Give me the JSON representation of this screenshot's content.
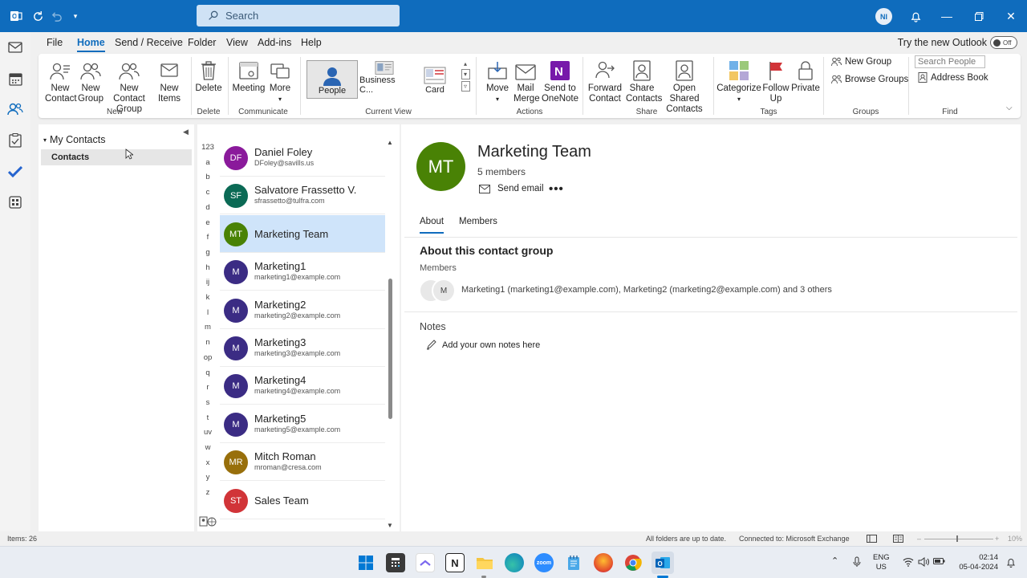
{
  "titlebar": {
    "search_placeholder": "Search",
    "avatar_initials": "NI"
  },
  "menu": {
    "tabs": [
      "File",
      "Home",
      "Send / Receive",
      "Folder",
      "View",
      "Add-ins",
      "Help"
    ],
    "active_tab": "Home",
    "try_new_label": "Try the new Outlook",
    "toggle_label": "Off"
  },
  "ribbon": {
    "new_contact": "New Contact",
    "new_group": "New Group",
    "new_contact_group": "New Contact Group",
    "new_items": "New Items",
    "group_new": "New",
    "delete": "Delete",
    "group_delete": "Delete",
    "meeting": "Meeting",
    "more": "More",
    "group_communicate": "Communicate",
    "view_people": "People",
    "view_business": "Business C...",
    "view_card": "Card",
    "group_current_view": "Current View",
    "move": "Move",
    "mail_merge": "Mail Merge",
    "send_onenote": "Send to OneNote",
    "group_actions": "Actions",
    "forward_contact": "Forward Contact",
    "share_contacts": "Share Contacts",
    "open_shared": "Open Shared Contacts",
    "group_share": "Share",
    "categorize": "Categorize",
    "follow_up": "Follow Up",
    "private": "Private",
    "group_tags": "Tags",
    "new_group_small": "New Group",
    "browse_groups": "Browse Groups",
    "group_groups": "Groups",
    "search_people_placeholder": "Search People",
    "address_book": "Address Book",
    "group_find": "Find"
  },
  "folder_pane": {
    "header": "My Contacts",
    "selected": "Contacts"
  },
  "alphabet": [
    "123",
    "a",
    "b",
    "c",
    "d",
    "e",
    "f",
    "g",
    "h",
    "ij",
    "k",
    "l",
    "m",
    "n",
    "op",
    "q",
    "r",
    "s",
    "t",
    "uv",
    "w",
    "x",
    "y",
    "z"
  ],
  "contacts": [
    {
      "initials": "DF",
      "name": "Daniel Foley",
      "email": "DFoley@savills.us",
      "color": "#8a1a9b"
    },
    {
      "initials": "SF",
      "name": "Salvatore Frassetto V.",
      "email": "sfrassetto@tulfra.com",
      "color": "#0b6a55"
    },
    {
      "initials": "MT",
      "name": "Marketing Team",
      "email": "",
      "color": "#498205"
    },
    {
      "initials": "M",
      "name": "Marketing1",
      "email": "marketing1@example.com",
      "color": "#3b2c84"
    },
    {
      "initials": "M",
      "name": "Marketing2",
      "email": "marketing2@example.com",
      "color": "#3b2c84"
    },
    {
      "initials": "M",
      "name": "Marketing3",
      "email": "marketing3@example.com",
      "color": "#3b2c84"
    },
    {
      "initials": "M",
      "name": "Marketing4",
      "email": "marketing4@example.com",
      "color": "#3b2c84"
    },
    {
      "initials": "M",
      "name": "Marketing5",
      "email": "marketing5@example.com",
      "color": "#3b2c84"
    },
    {
      "initials": "MR",
      "name": "Mitch Roman",
      "email": "mroman@cresa.com",
      "color": "#986f0b"
    },
    {
      "initials": "ST",
      "name": "Sales Team",
      "email": "",
      "color": "#d13438"
    }
  ],
  "reading_pane": {
    "initials": "MT",
    "name": "Marketing Team",
    "member_count": "5 members",
    "send_email": "Send email",
    "tabs": [
      "About",
      "Members"
    ],
    "about_title": "About this contact group",
    "members_label": "Members",
    "members_text": "Marketing1 (marketing1@example.com), Marketing2 (marketing2@example.com) and 3 others",
    "notes_label": "Notes",
    "add_notes": "Add your own notes here",
    "member_avatar": "M"
  },
  "statusbar": {
    "items": "Items: 26",
    "sync": "All folders are up to date.",
    "connection": "Connected to: Microsoft Exchange",
    "zoom": "10%"
  },
  "taskbar": {
    "lang": "ENG",
    "region": "US",
    "time": "02:14",
    "date": "05-04-2024"
  }
}
